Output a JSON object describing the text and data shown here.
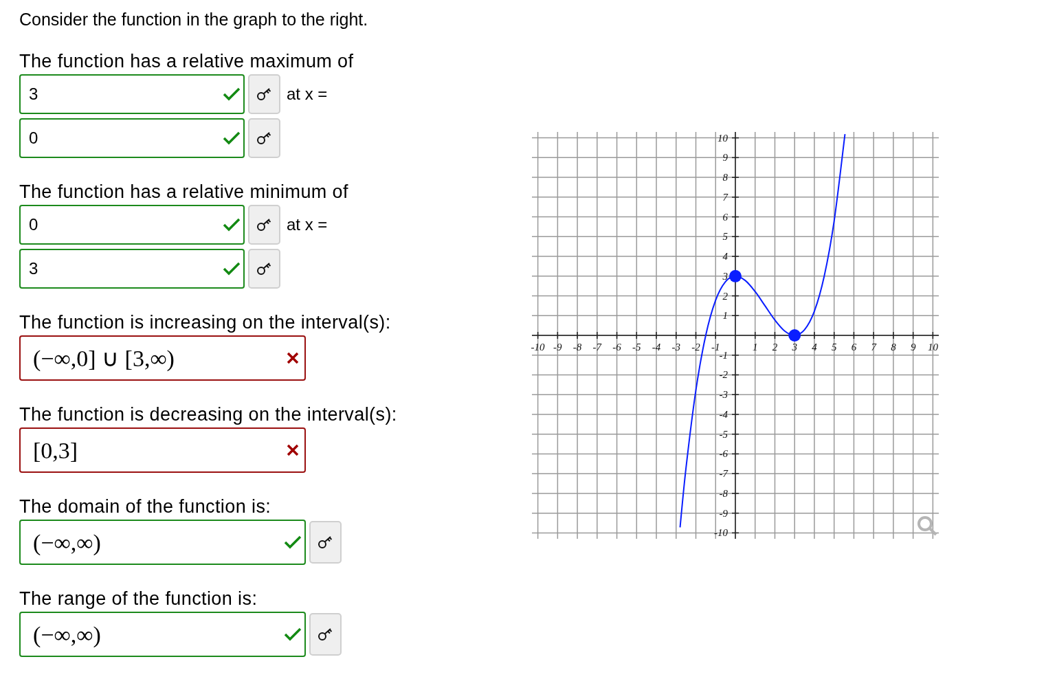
{
  "prompt": "Consider the function in the graph to the right.",
  "questions": [
    {
      "kind": "pair",
      "label": "The function has a relative maximum of",
      "connector": "at x =",
      "answers": [
        {
          "value": "3",
          "correct": true
        },
        {
          "value": "0",
          "correct": true
        }
      ]
    },
    {
      "kind": "pair",
      "label": "The function has a relative minimum of",
      "connector": "at x =",
      "answers": [
        {
          "value": "0",
          "correct": true
        },
        {
          "value": "3",
          "correct": true
        }
      ]
    },
    {
      "kind": "interval",
      "label": "The function is increasing on the interval(s):",
      "answers": [
        {
          "value": "(−∞,0] ∪ [3,∞)",
          "correct": false
        }
      ]
    },
    {
      "kind": "interval",
      "label": "The function is decreasing on the interval(s):",
      "answers": [
        {
          "value": "[0,3]",
          "correct": false
        }
      ]
    },
    {
      "kind": "interval",
      "label": "The domain of the function is:",
      "answers": [
        {
          "value": "(−∞,∞)",
          "correct": true
        }
      ]
    },
    {
      "kind": "interval",
      "label": "The range of the function is:",
      "answers": [
        {
          "value": "(−∞,∞)",
          "correct": true
        }
      ]
    }
  ],
  "graph": {
    "chart_data": {
      "type": "line",
      "grid": true,
      "x": [
        -2.8,
        -2.5,
        -2,
        -1.5,
        -1,
        -0.5,
        0,
        0.5,
        1,
        1.5,
        2,
        2.5,
        3,
        3.5,
        4,
        4.5,
        5,
        5.55
      ],
      "series": [
        {
          "color": "#0a1eff",
          "values": [
            -9.72,
            -6.72,
            -2.78,
            0,
            1.78,
            2.72,
            3,
            2.78,
            2.22,
            1.5,
            0.78,
            0.22,
            0,
            0.28,
            1.22,
            3,
            5.78,
            10.19
          ]
        }
      ],
      "xlim": [
        -10.3,
        10.3
      ],
      "ylim": [
        -10.3,
        10.3
      ],
      "xticks": [
        -10,
        -9,
        -8,
        -7,
        -6,
        -5,
        -4,
        -3,
        -2,
        -1,
        1,
        2,
        3,
        4,
        5,
        6,
        7,
        8,
        9,
        10
      ],
      "yticks": [
        -10,
        -9,
        -8,
        -7,
        -6,
        -5,
        -4,
        -3,
        -2,
        -1,
        1,
        2,
        3,
        4,
        5,
        6,
        7,
        8,
        9,
        10
      ]
    }
  }
}
